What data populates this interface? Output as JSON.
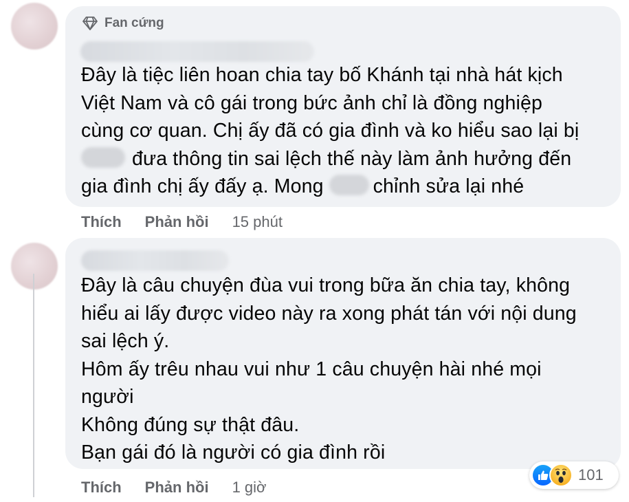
{
  "comments": [
    {
      "badge": "Fan cứng",
      "badge_icon": "diamond-icon",
      "lines": {
        "l1": "Đây là tiệc liên hoan chia tay bố Khánh tại nhà hát kịch",
        "l2": "Việt Nam và cô gái trong bức ảnh chỉ là đồng nghiệp",
        "l3": "cùng cơ quan. Chị ấy đã có gia đình và ko hiểu sao lại bị",
        "l4": "đưa thông tin sai lệch thế này làm ảnh hưởng đến",
        "l5a": "gia đình chị ấy đấy ạ. Mong",
        "l5b": "chỉnh sửa lại nhé"
      },
      "like_label": "Thích",
      "reply_label": "Phản hồi",
      "time": "15 phút"
    },
    {
      "lines": {
        "l1": "Đây là câu chuyện đùa vui trong bữa ăn chia tay, không",
        "l2": "hiểu ai lấy được video này ra xong phát tán với nội dung",
        "l3": "sai lệch ý.",
        "l4": "Hôm ấy trêu nhau vui như 1 câu chuyện hài nhé mọi",
        "l5": "người",
        "l6": "Không đúng sự thật đâu.",
        "l7": "Bạn gái đó là người có gia đình rồi"
      },
      "like_label": "Thích",
      "reply_label": "Phản hồi",
      "time": "1 giờ",
      "reactions": {
        "icons": [
          "like-icon",
          "wow-icon"
        ],
        "count": "101"
      }
    }
  ],
  "colors": {
    "bubble": "#f0f2f5",
    "meta_text": "#65676b",
    "body_text": "#050505",
    "like_blue": "#0866ff"
  }
}
